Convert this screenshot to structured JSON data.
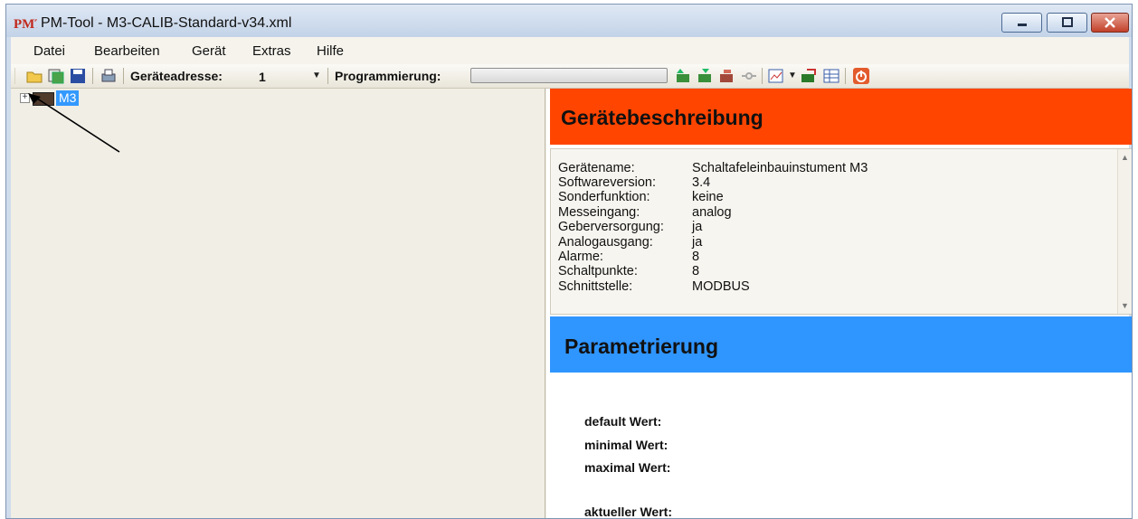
{
  "window": {
    "title": "PM-Tool - M3-CALIB-Standard-v34.xml",
    "logo_text": "PMT"
  },
  "menu": {
    "items": [
      "Datei",
      "Bearbeiten",
      "Gerät",
      "Extras",
      "Hilfe"
    ]
  },
  "toolbar": {
    "address_label": "Geräteadresse:",
    "address_value": "1",
    "programming_label": "Programmierung:",
    "programming_progress": 0,
    "icons": [
      "open-folder-icon",
      "save-all-icon",
      "save-icon",
      "print-icon",
      "read-device-icon",
      "write-device-icon",
      "transfer-icon",
      "connect-icon",
      "chart-icon",
      "export-icon",
      "table-icon",
      "power-icon"
    ]
  },
  "tree": {
    "root_label": "M3",
    "expander": "+"
  },
  "device_description": {
    "title": "Gerätebeschreibung",
    "rows": [
      {
        "key": "Gerätename:",
        "value": "Schaltafeleinbauinstument M3"
      },
      {
        "key": "Softwareversion:",
        "value": "3.4"
      },
      {
        "key": "Sonderfunktion:",
        "value": "keine"
      },
      {
        "key": "Messeingang:",
        "value": "analog"
      },
      {
        "key": "Geberversorgung:",
        "value": "ja"
      },
      {
        "key": "Analogausgang:",
        "value": "ja"
      },
      {
        "key": "Alarme:",
        "value": "8"
      },
      {
        "key": "Schaltpunkte:",
        "value": "8"
      },
      {
        "key": "Schnittstelle:",
        "value": "MODBUS"
      }
    ]
  },
  "parametrization": {
    "title": "Parametrierung",
    "default_label": "default Wert:",
    "min_label": "minimal Wert:",
    "max_label": "maximal Wert:",
    "current_label": "aktueller Wert:"
  },
  "colors": {
    "desc_header": "#ff4500",
    "param_header": "#2f95ff",
    "tree_selection": "#3399ff"
  }
}
